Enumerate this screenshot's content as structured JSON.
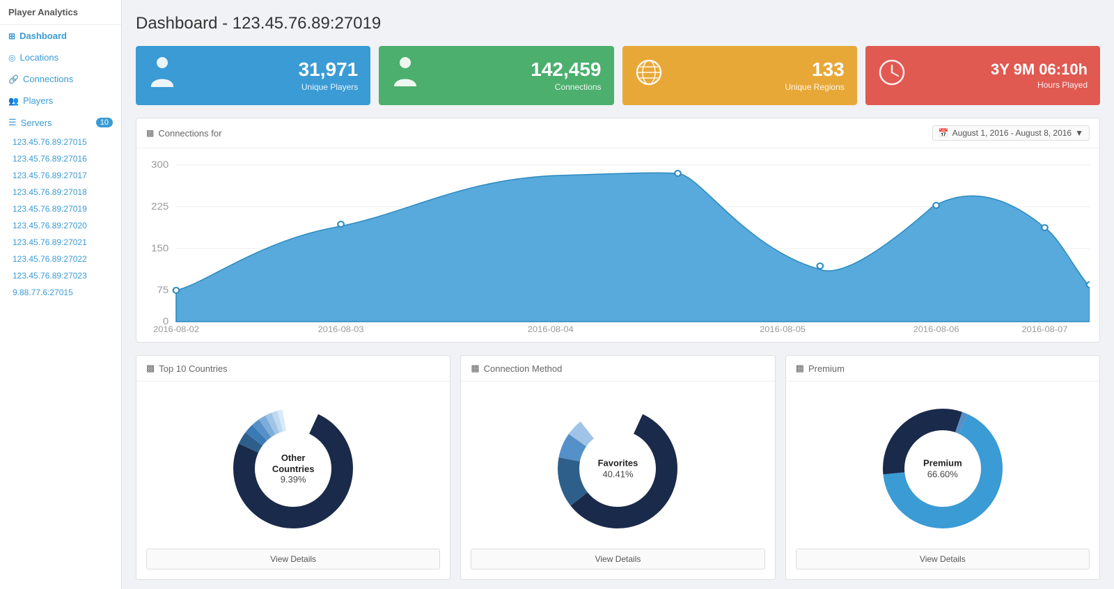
{
  "app": {
    "title": "Player Analytics"
  },
  "sidebar": {
    "nav": [
      {
        "id": "dashboard",
        "label": "Dashboard",
        "icon": "⊞",
        "active": true
      },
      {
        "id": "locations",
        "label": "Locations",
        "icon": "◎"
      },
      {
        "id": "connections",
        "label": "Connections",
        "icon": "🔗"
      },
      {
        "id": "players",
        "label": "Players",
        "icon": "👥"
      }
    ],
    "servers_label": "Servers",
    "servers_badge": "10",
    "servers": [
      "123.45.76.89:27015",
      "123.45.76.89:27016",
      "123.45.76.89:27017",
      "123.45.76.89:27018",
      "123.45.76.89:27019",
      "123.45.76.89:27020",
      "123.45.76.89:27021",
      "123.45.76.89:27022",
      "123.45.76.89:27023",
      "9.88.77.6:27015"
    ]
  },
  "header": {
    "title": "Dashboard - 123.45.76.89:27019"
  },
  "stat_cards": [
    {
      "id": "unique-players",
      "value": "31,971",
      "label": "Unique Players",
      "color": "blue",
      "icon": "person"
    },
    {
      "id": "connections",
      "value": "142,459",
      "label": "Connections",
      "color": "green",
      "icon": "person"
    },
    {
      "id": "unique-regions",
      "value": "133",
      "label": "Unique Regions",
      "color": "orange",
      "icon": "globe"
    },
    {
      "id": "hours-played",
      "value": "3Y 9M 06:10h",
      "label": "Hours Played",
      "color": "red",
      "icon": "clock"
    }
  ],
  "connections_chart": {
    "title": "Connections for",
    "date_range": "August 1, 2016 - August 8, 2016",
    "y_labels": [
      "0",
      "75",
      "150",
      "225",
      "300"
    ],
    "x_labels": [
      "2016-08-02",
      "2016-08-03",
      "2016-08-04",
      "2016-08-05",
      "2016-08-06",
      "2016-08-07"
    ]
  },
  "bottom_panels": [
    {
      "id": "top-countries",
      "title": "Top 10 Countries",
      "center_label": "Other Countries",
      "center_pct": "9.39%",
      "view_details": "View Details",
      "donut_type": "countries"
    },
    {
      "id": "connection-method",
      "title": "Connection Method",
      "center_label": "Favorites",
      "center_pct": "40.41%",
      "view_details": "View Details",
      "donut_type": "connection"
    },
    {
      "id": "premium",
      "title": "Premium",
      "center_label": "Premium",
      "center_pct": "66.60%",
      "view_details": "View Details",
      "donut_type": "premium"
    }
  ]
}
